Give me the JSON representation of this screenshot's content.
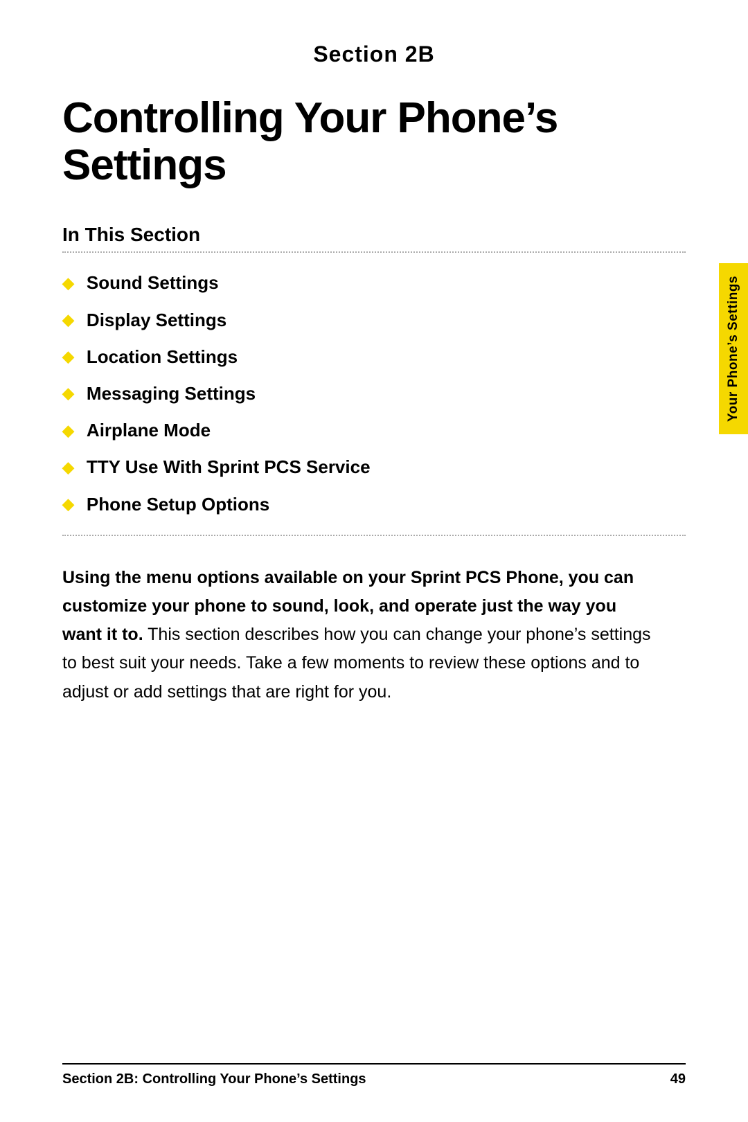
{
  "section_label": "Section 2B",
  "page_title": "Controlling Your Phone’s Settings",
  "in_this_section": "In This Section",
  "toc_items": [
    "Sound Settings",
    "Display Settings",
    "Location Settings",
    "Messaging Settings",
    "Airplane Mode",
    "TTY Use With Sprint PCS Service",
    "Phone Setup Options"
  ],
  "intro_bold": "Using the menu options available on your Sprint PCS Phone, you can customize your phone to sound, look, and operate just the way you want it to.",
  "intro_normal": " This section describes how you can change your phone’s settings to best suit your needs. Take a few moments to review these options and to adjust or add settings that are right for you.",
  "side_tab_text": "Your Phone’s Settings",
  "footer_left": "Section 2B: Controlling Your Phone’s Settings",
  "footer_right": "49"
}
